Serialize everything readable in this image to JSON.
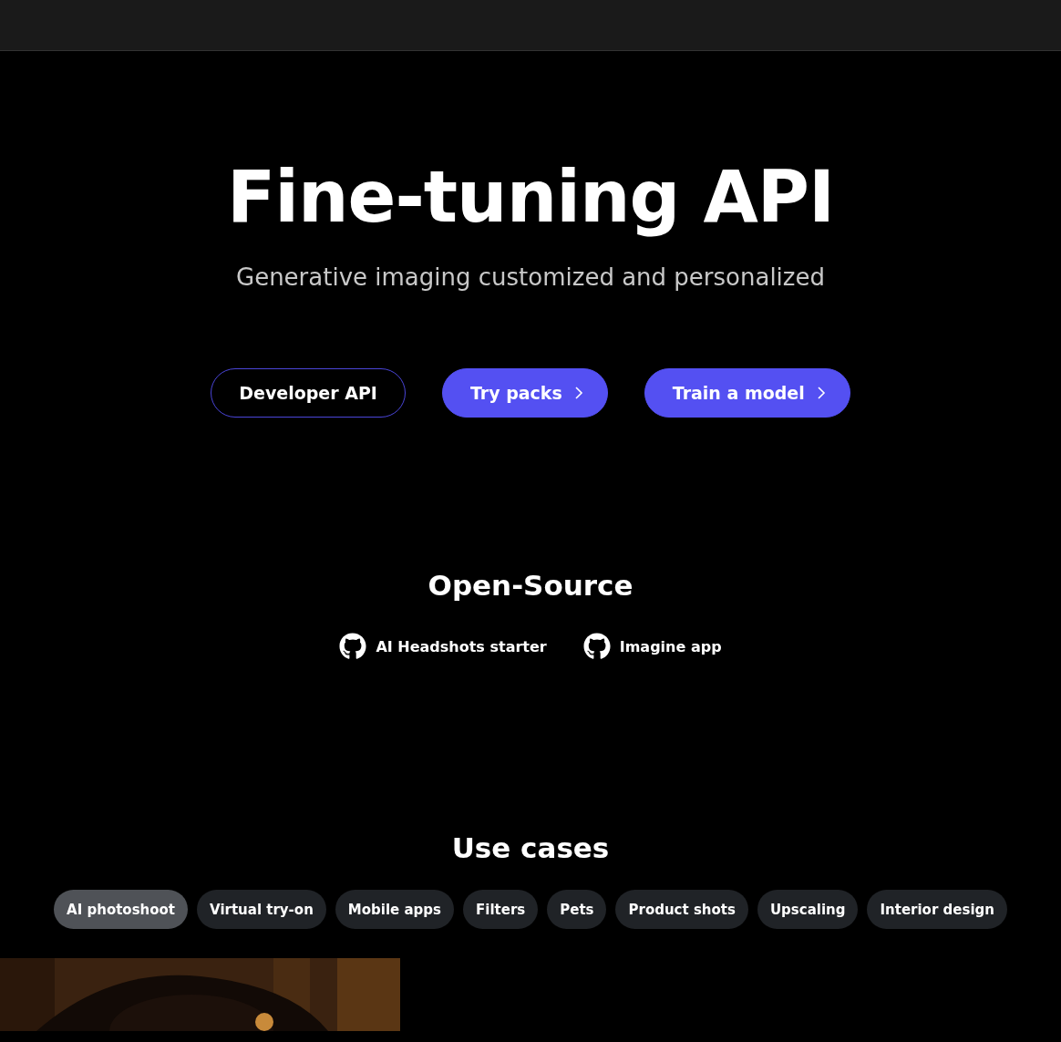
{
  "hero": {
    "title": "Fine-tuning API",
    "subtitle": "Generative imaging customized and personalized",
    "buttons": [
      {
        "label": "Developer API",
        "kind": "outline",
        "chevron": false
      },
      {
        "label": "Try packs",
        "kind": "filled",
        "chevron": true
      },
      {
        "label": "Train a model",
        "kind": "filled",
        "chevron": true
      }
    ]
  },
  "open_source": {
    "heading": "Open-Source",
    "links": [
      "AI Headshots starter",
      "Imagine app"
    ]
  },
  "use_cases": {
    "heading": "Use cases",
    "tabs": [
      {
        "label": "AI photoshoot",
        "selected": true
      },
      {
        "label": "Virtual try-on",
        "selected": false
      },
      {
        "label": "Mobile apps",
        "selected": false
      },
      {
        "label": "Filters",
        "selected": false
      },
      {
        "label": "Pets",
        "selected": false
      },
      {
        "label": "Product shots",
        "selected": false
      },
      {
        "label": "Upscaling",
        "selected": false
      },
      {
        "label": "Interior design",
        "selected": false
      }
    ]
  }
}
